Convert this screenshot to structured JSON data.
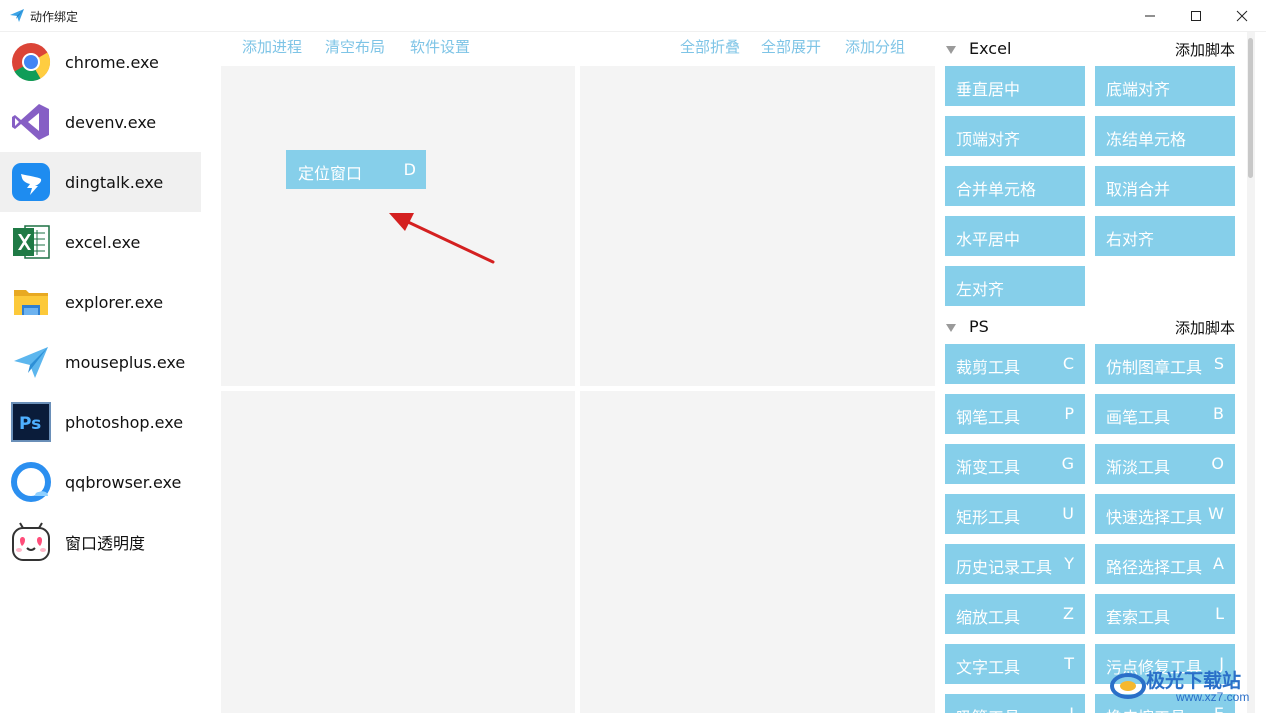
{
  "window": {
    "title": "动作绑定"
  },
  "sidebar": {
    "items": [
      {
        "label": "chrome.exe",
        "icon": "chrome-icon",
        "selected": false
      },
      {
        "label": "devenv.exe",
        "icon": "visual-studio-icon",
        "selected": false
      },
      {
        "label": "dingtalk.exe",
        "icon": "dingtalk-icon",
        "selected": true
      },
      {
        "label": "excel.exe",
        "icon": "excel-icon",
        "selected": false
      },
      {
        "label": "explorer.exe",
        "icon": "folder-icon",
        "selected": false
      },
      {
        "label": "mouseplus.exe",
        "icon": "paper-plane-icon",
        "selected": false
      },
      {
        "label": "photoshop.exe",
        "icon": "photoshop-icon",
        "selected": false
      },
      {
        "label": "qqbrowser.exe",
        "icon": "qqbrowser-icon",
        "selected": false
      },
      {
        "label": "窗口透明度",
        "icon": "cute-face-icon",
        "selected": false
      }
    ]
  },
  "toolbar": {
    "add_process": "添加进程",
    "clear_layout": "清空布局",
    "settings": "软件设置",
    "collapse_all": "全部折叠",
    "expand_all": "全部展开",
    "add_group": "添加分组"
  },
  "grid": {
    "bound_action": {
      "label": "定位窗口",
      "key": "D"
    }
  },
  "groups": [
    {
      "name": "Excel",
      "add_label": "添加脚本",
      "scripts": [
        {
          "label": "垂直居中",
          "key": ""
        },
        {
          "label": "底端对齐",
          "key": ""
        },
        {
          "label": "顶端对齐",
          "key": ""
        },
        {
          "label": "冻结单元格",
          "key": ""
        },
        {
          "label": "合并单元格",
          "key": ""
        },
        {
          "label": "取消合并",
          "key": ""
        },
        {
          "label": "水平居中",
          "key": ""
        },
        {
          "label": "右对齐",
          "key": ""
        },
        {
          "label": "左对齐",
          "key": ""
        }
      ]
    },
    {
      "name": "PS",
      "add_label": "添加脚本",
      "scripts": [
        {
          "label": "裁剪工具",
          "key": "C"
        },
        {
          "label": "仿制图章工具",
          "key": "S"
        },
        {
          "label": "钢笔工具",
          "key": "P"
        },
        {
          "label": "画笔工具",
          "key": "B"
        },
        {
          "label": "渐变工具",
          "key": "G"
        },
        {
          "label": "渐淡工具",
          "key": "O"
        },
        {
          "label": "矩形工具",
          "key": "U"
        },
        {
          "label": "快速选择工具",
          "key": "W"
        },
        {
          "label": "历史记录工具",
          "key": "Y"
        },
        {
          "label": "路径选择工具",
          "key": "A"
        },
        {
          "label": "缩放工具",
          "key": "Z"
        },
        {
          "label": "套索工具",
          "key": "L"
        },
        {
          "label": "文字工具",
          "key": "T"
        },
        {
          "label": "污点修复工具",
          "key": "J"
        },
        {
          "label": "吸管工具",
          "key": "I"
        },
        {
          "label": "橡皮擦工具",
          "key": "E"
        }
      ]
    }
  ],
  "watermark": {
    "text": "极光下载站",
    "url": "www.xz7.com"
  },
  "colors": {
    "accent": "#86cfea",
    "link": "#7ec4e6",
    "cell_bg": "#f4f4f4",
    "arrow": "#d42020"
  }
}
